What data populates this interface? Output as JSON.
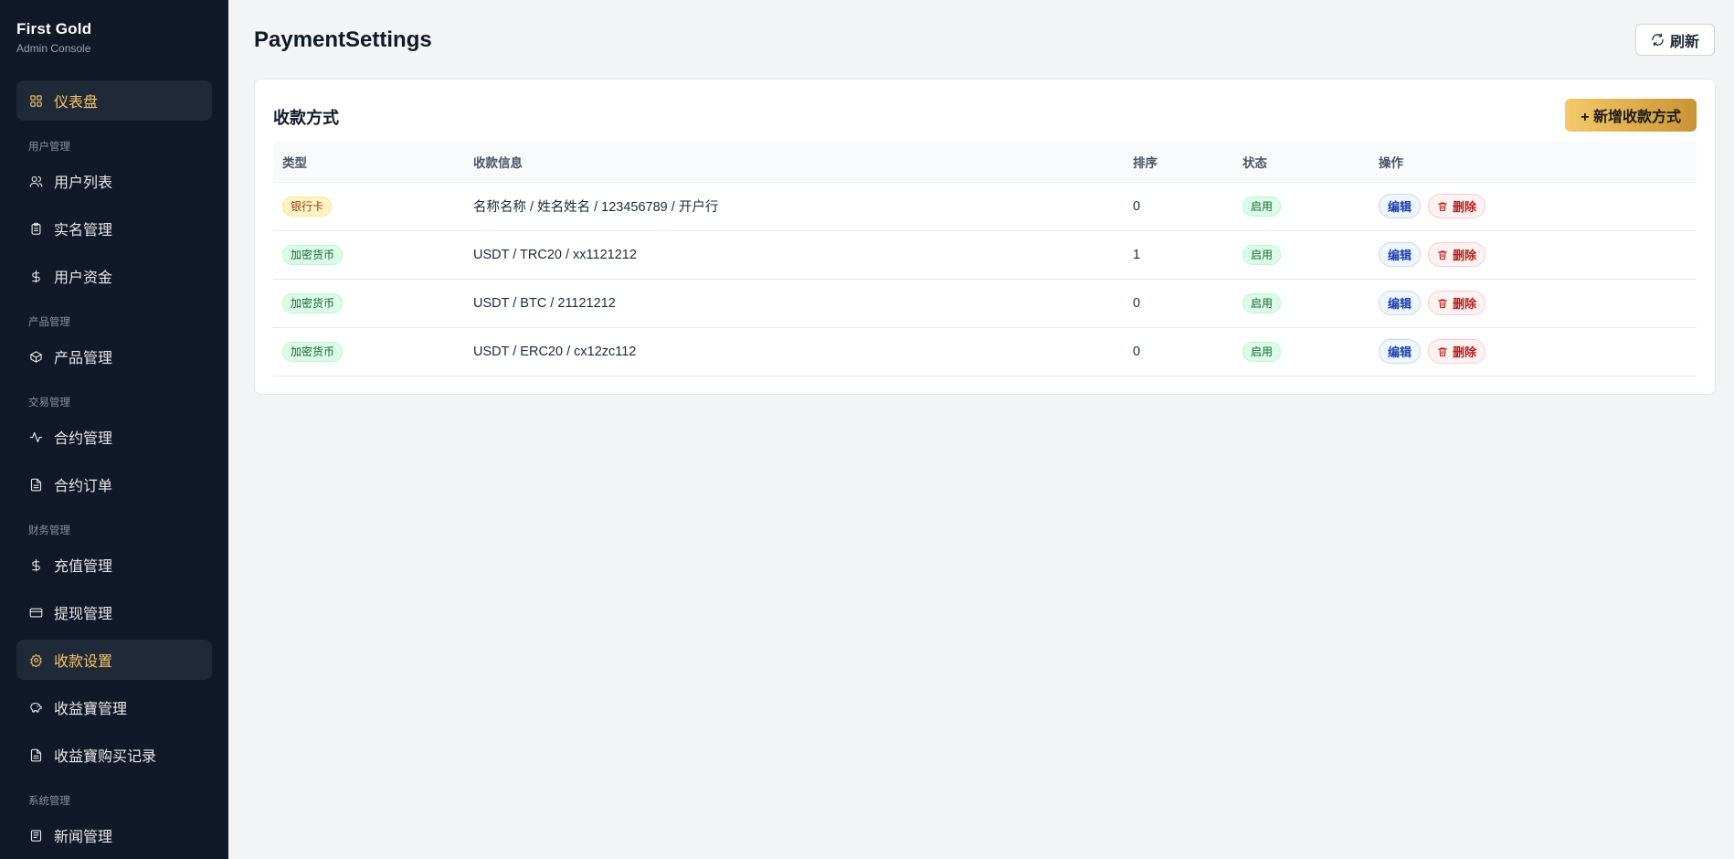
{
  "brand": {
    "title": "First Gold",
    "subtitle": "Admin Console"
  },
  "sidebar": {
    "items": [
      {
        "type": "item",
        "label": "仪表盘",
        "icon": "grid-icon",
        "active": true
      },
      {
        "type": "group",
        "label": "用户管理"
      },
      {
        "type": "item",
        "label": "用户列表",
        "icon": "users-icon"
      },
      {
        "type": "item",
        "label": "实名管理",
        "icon": "clipboard-icon"
      },
      {
        "type": "item",
        "label": "用户资金",
        "icon": "dollar-icon"
      },
      {
        "type": "group",
        "label": "产品管理"
      },
      {
        "type": "item",
        "label": "产品管理",
        "icon": "box-icon"
      },
      {
        "type": "group",
        "label": "交易管理"
      },
      {
        "type": "item",
        "label": "合约管理",
        "icon": "activity-icon"
      },
      {
        "type": "item",
        "label": "合约订单",
        "icon": "file-icon"
      },
      {
        "type": "group",
        "label": "财务管理"
      },
      {
        "type": "item",
        "label": "充值管理",
        "icon": "dollar-icon"
      },
      {
        "type": "item",
        "label": "提现管理",
        "icon": "card-icon"
      },
      {
        "type": "item",
        "label": "收款设置",
        "icon": "gear-icon",
        "active": true
      },
      {
        "type": "item",
        "label": "收益寶管理",
        "icon": "piggy-bank-icon"
      },
      {
        "type": "item",
        "label": "收益寶购买记录",
        "icon": "file-icon"
      },
      {
        "type": "group",
        "label": "系统管理"
      },
      {
        "type": "item",
        "label": "新闻管理",
        "icon": "newspaper-icon"
      }
    ]
  },
  "header": {
    "title": "PaymentSettings",
    "refresh_label": "刷新"
  },
  "card": {
    "title": "收款方式",
    "add_label": "+ 新增收款方式"
  },
  "table": {
    "columns": [
      "类型",
      "收款信息",
      "排序",
      "状态",
      "操作"
    ],
    "rows": [
      {
        "type": "银行卡",
        "kind": "bank",
        "info": "名称名称 / 姓名姓名 / 123456789 / 开户行",
        "sort": "0",
        "status": "启用"
      },
      {
        "type": "加密货币",
        "kind": "crypto",
        "info": "USDT / TRC20 / xx1121212",
        "sort": "1",
        "status": "启用"
      },
      {
        "type": "加密货币",
        "kind": "crypto",
        "info": "USDT / BTC / 21121212",
        "sort": "0",
        "status": "启用"
      },
      {
        "type": "加密货币",
        "kind": "crypto",
        "info": "USDT / ERC20 / cx12zc112",
        "sort": "0",
        "status": "启用"
      }
    ],
    "edit_label": "编辑",
    "delete_label": "删除"
  },
  "colors": {
    "sidebar_bg": "#111827",
    "accent": "#f4c66a",
    "page_bg": "#f3f4f6"
  }
}
